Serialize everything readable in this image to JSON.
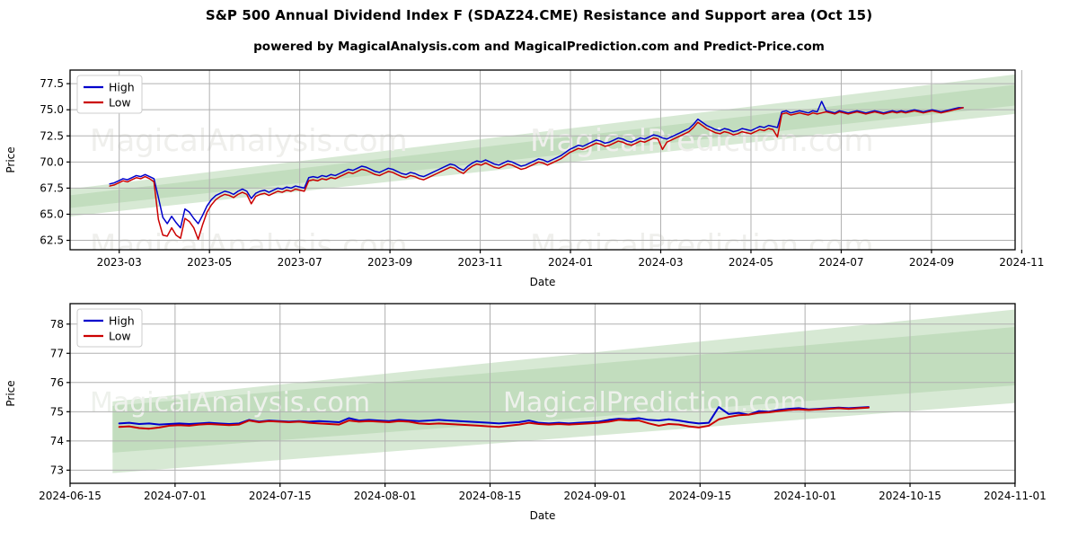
{
  "header": {
    "title": "S&P 500 Annual Dividend Index F (SDAZ24.CME) Resistance and Support area (Oct 15)",
    "subtitle": "powered by MagicalAnalysis.com and MagicalPrediction.com and Predict-Price.com"
  },
  "watermarks": {
    "left": "MagicalAnalysis.com",
    "right": "MagicalPrediction.com"
  },
  "colors": {
    "high": "#0000cc",
    "low": "#cc0000",
    "band_outer": "#d7e9d4",
    "band_inner": "#c2ddbe",
    "grid": "#b0b0b0",
    "axis": "#000000"
  },
  "chart_data": [
    {
      "id": "top",
      "type": "line",
      "title": "S&P 500 Annual Dividend Index F (SDAZ24.CME) Resistance and Support area (Oct 15)",
      "xlabel": "Date",
      "ylabel": "Price",
      "ylim": [
        61.6,
        78.8
      ],
      "yticks": [
        62.5,
        65.0,
        67.5,
        70.0,
        72.5,
        75.0,
        77.5
      ],
      "ytick_labels": [
        "62.5",
        "65.0",
        "67.5",
        "70.0",
        "72.5",
        "75.0",
        "77.5"
      ],
      "xlim": [
        "2023-02-01",
        "2024-11-20"
      ],
      "xticks": [
        "2023-03",
        "2023-05",
        "2023-07",
        "2023-09",
        "2023-11",
        "2024-01",
        "2024-03",
        "2024-05",
        "2024-07",
        "2024-09",
        "2024-11"
      ],
      "grid": true,
      "legend": {
        "position": "upper-left",
        "entries": [
          {
            "label": "High",
            "color": "#0000cc"
          },
          {
            "label": "Low",
            "color": "#cc0000"
          }
        ]
      },
      "bands": {
        "outer": {
          "left_low": 64.6,
          "left_high": 67.2,
          "right_low": 74.8,
          "right_high": 78.6
        },
        "inner": {
          "left_low": 65.4,
          "left_high": 66.6,
          "right_low": 75.6,
          "right_high": 77.6
        }
      },
      "series": [
        {
          "name": "High",
          "color": "#0000cc",
          "values": [
            67.9,
            68.0,
            68.2,
            68.4,
            68.3,
            68.5,
            68.7,
            68.6,
            68.8,
            68.6,
            68.4,
            66.6,
            64.7,
            64.1,
            64.8,
            64.2,
            63.7,
            65.5,
            65.2,
            64.6,
            64.1,
            64.9,
            65.8,
            66.4,
            66.8,
            67.0,
            67.2,
            67.1,
            66.9,
            67.2,
            67.4,
            67.2,
            66.5,
            67.0,
            67.2,
            67.3,
            67.1,
            67.3,
            67.5,
            67.4,
            67.6,
            67.5,
            67.7,
            67.6,
            67.5,
            68.5,
            68.6,
            68.5,
            68.7,
            68.6,
            68.8,
            68.7,
            68.9,
            69.1,
            69.3,
            69.2,
            69.4,
            69.6,
            69.5,
            69.3,
            69.1,
            69.0,
            69.2,
            69.4,
            69.3,
            69.1,
            68.9,
            68.8,
            69.0,
            68.9,
            68.7,
            68.6,
            68.8,
            69.0,
            69.2,
            69.4,
            69.6,
            69.8,
            69.7,
            69.4,
            69.2,
            69.6,
            69.9,
            70.1,
            70.0,
            70.2,
            70.0,
            69.8,
            69.7,
            69.9,
            70.1,
            70.0,
            69.8,
            69.6,
            69.7,
            69.9,
            70.1,
            70.3,
            70.2,
            70.0,
            70.2,
            70.4,
            70.6,
            70.9,
            71.2,
            71.4,
            71.6,
            71.5,
            71.7,
            71.9,
            72.1,
            72.0,
            71.8,
            71.9,
            72.1,
            72.3,
            72.2,
            72.0,
            71.9,
            72.1,
            72.3,
            72.2,
            72.4,
            72.6,
            72.5,
            72.3,
            72.2,
            72.4,
            72.6,
            72.8,
            73.0,
            73.2,
            73.6,
            74.1,
            73.8,
            73.5,
            73.3,
            73.1,
            73.0,
            73.2,
            73.1,
            72.9,
            73.0,
            73.2,
            73.1,
            73.0,
            73.2,
            73.4,
            73.3,
            73.5,
            73.4,
            73.3,
            74.8,
            74.9,
            74.7,
            74.8,
            74.9,
            74.8,
            74.7,
            74.9,
            74.8,
            75.8,
            74.9,
            74.8,
            74.7,
            74.9,
            74.8,
            74.7,
            74.8,
            74.9,
            74.8,
            74.7,
            74.8,
            74.9,
            74.8,
            74.7,
            74.8,
            74.9,
            74.8,
            74.9,
            74.8,
            74.9,
            75.0,
            74.9,
            74.8,
            74.9,
            75.0,
            74.9,
            74.8,
            74.9,
            75.0,
            75.1,
            75.2,
            75.2
          ]
        },
        {
          "name": "Low",
          "color": "#cc0000",
          "values": [
            67.7,
            67.8,
            68.0,
            68.2,
            68.1,
            68.3,
            68.5,
            68.4,
            68.6,
            68.4,
            68.1,
            64.5,
            63.0,
            62.9,
            63.7,
            63.0,
            62.7,
            64.6,
            64.3,
            63.7,
            62.6,
            64.0,
            65.2,
            65.9,
            66.4,
            66.7,
            66.9,
            66.8,
            66.6,
            66.9,
            67.1,
            66.9,
            66.0,
            66.7,
            66.9,
            67.0,
            66.8,
            67.0,
            67.2,
            67.1,
            67.3,
            67.2,
            67.4,
            67.3,
            67.2,
            68.2,
            68.3,
            68.2,
            68.4,
            68.3,
            68.5,
            68.4,
            68.6,
            68.8,
            69.0,
            68.9,
            69.1,
            69.3,
            69.2,
            69.0,
            68.8,
            68.7,
            68.9,
            69.1,
            69.0,
            68.8,
            68.6,
            68.5,
            68.7,
            68.6,
            68.4,
            68.3,
            68.5,
            68.7,
            68.9,
            69.1,
            69.3,
            69.5,
            69.4,
            69.1,
            68.9,
            69.3,
            69.6,
            69.8,
            69.7,
            69.9,
            69.7,
            69.5,
            69.4,
            69.6,
            69.8,
            69.7,
            69.5,
            69.3,
            69.4,
            69.6,
            69.8,
            70.0,
            69.9,
            69.7,
            69.9,
            70.1,
            70.3,
            70.6,
            70.9,
            71.1,
            71.3,
            71.2,
            71.4,
            71.6,
            71.8,
            71.7,
            71.5,
            71.6,
            71.8,
            72.0,
            71.9,
            71.7,
            71.6,
            71.8,
            72.0,
            71.9,
            72.1,
            72.3,
            72.2,
            71.2,
            71.9,
            72.1,
            72.3,
            72.5,
            72.7,
            72.9,
            73.3,
            73.8,
            73.5,
            73.2,
            73.0,
            72.8,
            72.7,
            72.9,
            72.8,
            72.6,
            72.7,
            72.9,
            72.8,
            72.7,
            72.9,
            73.1,
            73.0,
            73.2,
            73.1,
            72.4,
            74.6,
            74.7,
            74.5,
            74.6,
            74.7,
            74.6,
            74.5,
            74.7,
            74.6,
            74.7,
            74.8,
            74.7,
            74.6,
            74.8,
            74.7,
            74.6,
            74.7,
            74.8,
            74.7,
            74.6,
            74.7,
            74.8,
            74.7,
            74.6,
            74.7,
            74.8,
            74.7,
            74.8,
            74.7,
            74.8,
            74.9,
            74.8,
            74.7,
            74.8,
            74.9,
            74.8,
            74.7,
            74.8,
            74.9,
            75.0,
            75.1,
            75.2
          ]
        }
      ]
    },
    {
      "id": "bottom",
      "type": "line",
      "xlabel": "Date",
      "ylabel": "Price",
      "ylim": [
        72.55,
        78.7
      ],
      "yticks": [
        73,
        74,
        75,
        76,
        77,
        78
      ],
      "ytick_labels": [
        "73",
        "74",
        "75",
        "76",
        "77",
        "78"
      ],
      "xlim": [
        "2024-06-10",
        "2024-11-04"
      ],
      "xticks": [
        "2024-06-15",
        "2024-07-01",
        "2024-07-15",
        "2024-08-01",
        "2024-08-15",
        "2024-09-01",
        "2024-09-15",
        "2024-10-01",
        "2024-10-15",
        "2024-11-01"
      ],
      "grid": true,
      "legend": {
        "position": "upper-left",
        "entries": [
          {
            "label": "High",
            "color": "#0000cc"
          },
          {
            "label": "Low",
            "color": "#cc0000"
          }
        ]
      },
      "bands": {
        "outer": {
          "left_low": 72.9,
          "left_high": 75.35,
          "right_low": 75.3,
          "right_high": 78.5
        },
        "inner": {
          "left_low": 73.6,
          "left_high": 75.2,
          "right_low": 75.9,
          "right_high": 77.9
        }
      },
      "series": [
        {
          "name": "High",
          "color": "#0000cc",
          "values": [
            74.6,
            74.62,
            74.58,
            74.6,
            74.56,
            74.58,
            74.6,
            74.58,
            74.6,
            74.62,
            74.6,
            74.58,
            74.6,
            74.72,
            74.66,
            74.7,
            74.68,
            74.66,
            74.68,
            74.66,
            74.68,
            74.66,
            74.64,
            74.78,
            74.7,
            74.72,
            74.7,
            74.68,
            74.72,
            74.7,
            74.68,
            74.7,
            74.72,
            74.7,
            74.68,
            74.66,
            74.64,
            74.62,
            74.6,
            74.62,
            74.64,
            74.7,
            74.62,
            74.6,
            74.62,
            74.6,
            74.62,
            74.64,
            74.66,
            74.72,
            74.76,
            74.74,
            74.78,
            74.72,
            74.7,
            74.74,
            74.7,
            74.64,
            74.6,
            74.62,
            75.16,
            74.92,
            74.96,
            74.9,
            75.02,
            75.0,
            75.06,
            75.1,
            75.12,
            75.08,
            75.1,
            75.12,
            75.14,
            75.12,
            75.14,
            75.16
          ]
        },
        {
          "name": "Low",
          "color": "#cc0000",
          "values": [
            74.48,
            74.5,
            74.44,
            74.42,
            74.46,
            74.52,
            74.54,
            74.52,
            74.56,
            74.58,
            74.56,
            74.54,
            74.56,
            74.7,
            74.64,
            74.68,
            74.66,
            74.64,
            74.66,
            74.62,
            74.6,
            74.58,
            74.56,
            74.7,
            74.66,
            74.68,
            74.66,
            74.64,
            74.68,
            74.66,
            74.6,
            74.58,
            74.6,
            74.58,
            74.56,
            74.54,
            74.52,
            74.5,
            74.48,
            74.52,
            74.56,
            74.62,
            74.58,
            74.56,
            74.58,
            74.56,
            74.58,
            74.6,
            74.62,
            74.66,
            74.72,
            74.7,
            74.7,
            74.6,
            74.52,
            74.58,
            74.56,
            74.5,
            74.46,
            74.52,
            74.74,
            74.82,
            74.88,
            74.9,
            74.96,
            74.98,
            75.02,
            75.06,
            75.08,
            75.06,
            75.08,
            75.1,
            75.12,
            75.1,
            75.12,
            75.14
          ]
        }
      ]
    }
  ]
}
